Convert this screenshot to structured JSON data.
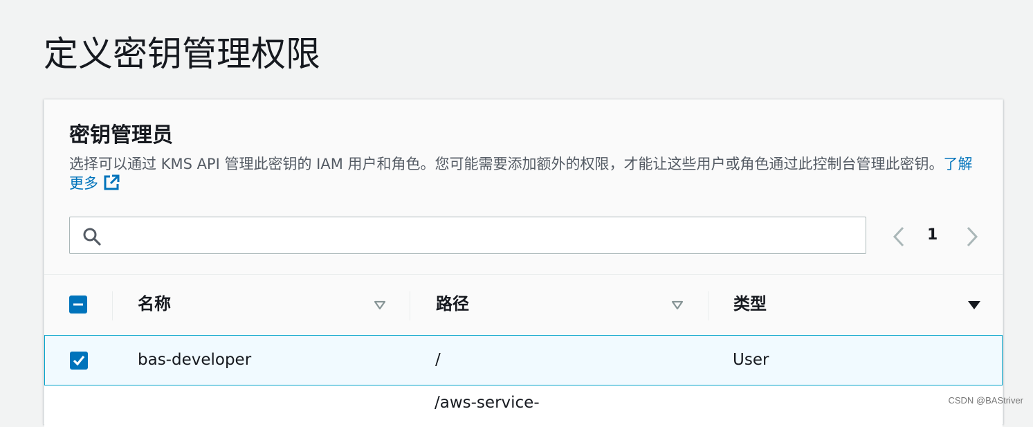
{
  "page": {
    "title": "定义密钥管理权限"
  },
  "panel": {
    "title": "密钥管理员",
    "description": "选择可以通过 KMS API 管理此密钥的 IAM 用户和角色。您可能需要添加额外的权限，才能让这些用户或角色通过此控制台管理此密钥。",
    "learn_more": "了解更多"
  },
  "search": {
    "value": "",
    "placeholder": ""
  },
  "pagination": {
    "current_page": "1"
  },
  "table": {
    "columns": [
      {
        "label": "名称",
        "sort": "unsorted"
      },
      {
        "label": "路径",
        "sort": "unsorted"
      },
      {
        "label": "类型",
        "sort": "descending"
      }
    ],
    "header_checkbox": "indeterminate",
    "rows": [
      {
        "selected": true,
        "name": "bas-developer",
        "path": "/",
        "type": "User"
      },
      {
        "selected": false,
        "name": "",
        "path": "/aws-service-",
        "type": ""
      }
    ]
  },
  "watermark": "CSDN @BAStriver",
  "colors": {
    "accent": "#0073bb",
    "selected_row_bg": "#f1faff",
    "selected_row_border": "#00a1c9",
    "checkbox_fill": "#0073bb"
  }
}
